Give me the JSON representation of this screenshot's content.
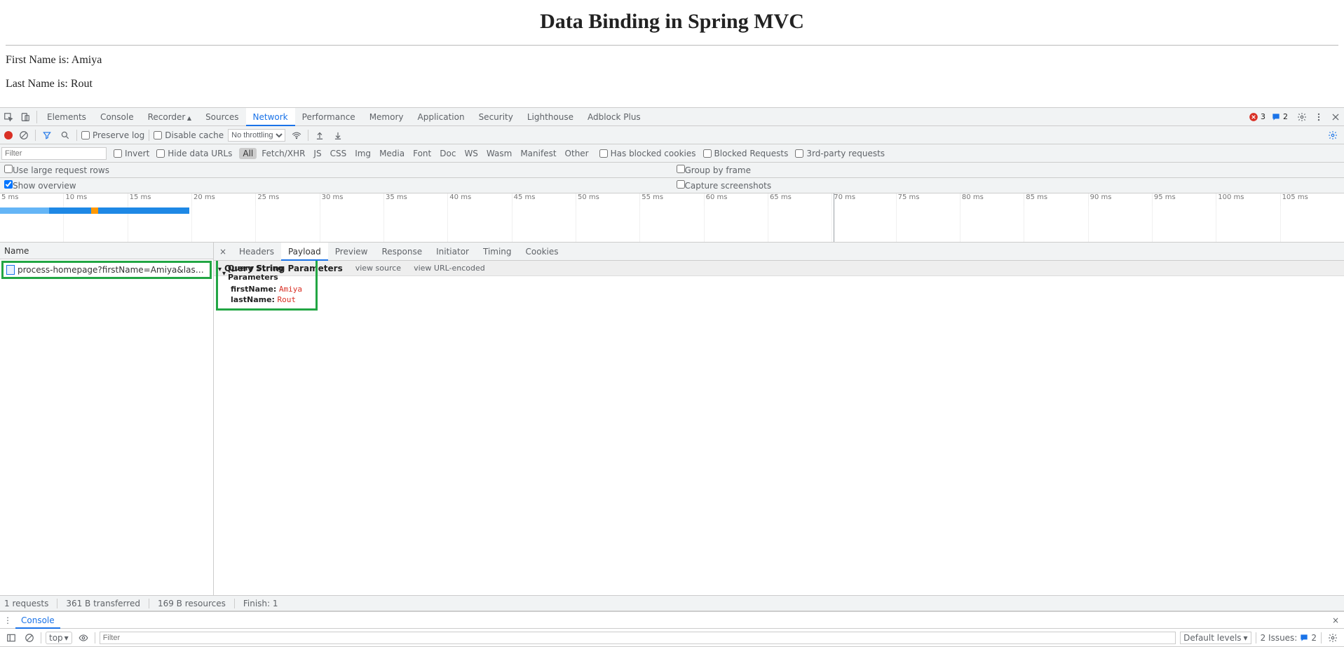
{
  "page": {
    "title": "Data Binding in Spring MVC",
    "line1_prefix": "First Name is: ",
    "line1_value": "Amiya",
    "line2_prefix": "Last Name is: ",
    "line2_value": "Rout"
  },
  "devtools_tabs": [
    "Elements",
    "Console",
    "Recorder",
    "Sources",
    "Network",
    "Performance",
    "Memory",
    "Application",
    "Security",
    "Lighthouse",
    "Adblock Plus"
  ],
  "devtools_active_tab": "Network",
  "error_count": "3",
  "message_count": "2",
  "network_toolbar": {
    "preserve_log": "Preserve log",
    "disable_cache": "Disable cache",
    "throttling": "No throttling"
  },
  "filter_row": {
    "placeholder": "Filter",
    "invert": "Invert",
    "hide_data_urls": "Hide data URLs",
    "types": [
      "All",
      "Fetch/XHR",
      "JS",
      "CSS",
      "Img",
      "Media",
      "Font",
      "Doc",
      "WS",
      "Wasm",
      "Manifest",
      "Other"
    ],
    "has_blocked_cookies": "Has blocked cookies",
    "blocked_requests": "Blocked Requests",
    "third_party": "3rd-party requests"
  },
  "opts": {
    "large_rows": "Use large request rows",
    "group_by_frame": "Group by frame",
    "show_overview": "Show overview",
    "capture_screenshots": "Capture screenshots"
  },
  "timeline_ticks": [
    "5 ms",
    "10 ms",
    "15 ms",
    "20 ms",
    "25 ms",
    "30 ms",
    "35 ms",
    "40 ms",
    "45 ms",
    "50 ms",
    "55 ms",
    "60 ms",
    "65 ms",
    "70 ms",
    "75 ms",
    "80 ms",
    "85 ms",
    "90 ms",
    "95 ms",
    "100 ms",
    "105 ms"
  ],
  "request_list": {
    "header": "Name",
    "rows": [
      {
        "name": "process-homepage?firstName=Amiya&lastName=Rout"
      }
    ]
  },
  "details_tabs": [
    "Headers",
    "Payload",
    "Preview",
    "Response",
    "Initiator",
    "Timing",
    "Cookies"
  ],
  "details_active": "Payload",
  "payload": {
    "section_title": "Query String Parameters",
    "view_source": "view source",
    "view_url_encoded": "view URL-encoded",
    "params": [
      {
        "k": "firstName:",
        "v": "Amiya"
      },
      {
        "k": "lastName:",
        "v": "Rout"
      }
    ]
  },
  "status_bar": {
    "requests": "1 requests",
    "transferred": "361 B transferred",
    "resources": "169 B resources",
    "finish": "Finish: 1"
  },
  "console": {
    "tab": "Console",
    "context": "top",
    "filter_placeholder": "Filter",
    "levels": "Default levels",
    "issues_label": "2 Issues:",
    "issues_count": "2"
  }
}
